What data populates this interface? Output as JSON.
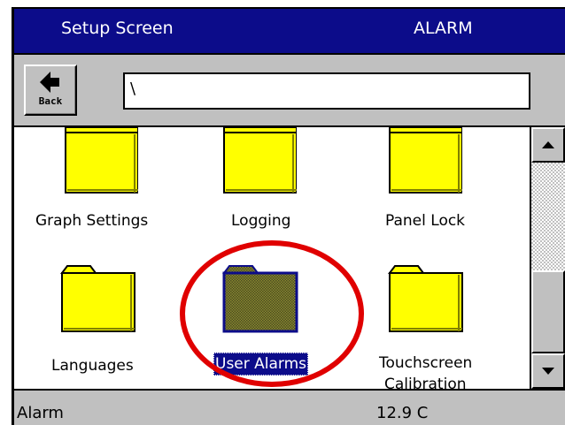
{
  "title_bar": {
    "title": "Setup Screen",
    "mode": "ALARM"
  },
  "toolbar": {
    "back_label": "Back",
    "path_value": "\\"
  },
  "folders": [
    {
      "label": "Graph Settings",
      "selected": false
    },
    {
      "label": "Logging",
      "selected": false
    },
    {
      "label": "Panel Lock",
      "selected": false
    },
    {
      "label": "Languages",
      "selected": false
    },
    {
      "label": "User Alarms",
      "selected": true
    },
    {
      "label_line1": "Touchscreen",
      "label_line2": "Calibration",
      "selected": false
    }
  ],
  "status_bar": {
    "left_text": "Alarm",
    "right_text": "12.9 C"
  },
  "colors": {
    "title_bar_bg": "#0c0c8a",
    "folder_fill": "#ffff00",
    "selection_bg": "#0c0c8a",
    "annotation": "#e00000"
  },
  "icons": {
    "back": "left-arrow-icon",
    "folder": "folder-icon",
    "scroll_up": "triangle-up-icon",
    "scroll_down": "triangle-down-icon"
  }
}
